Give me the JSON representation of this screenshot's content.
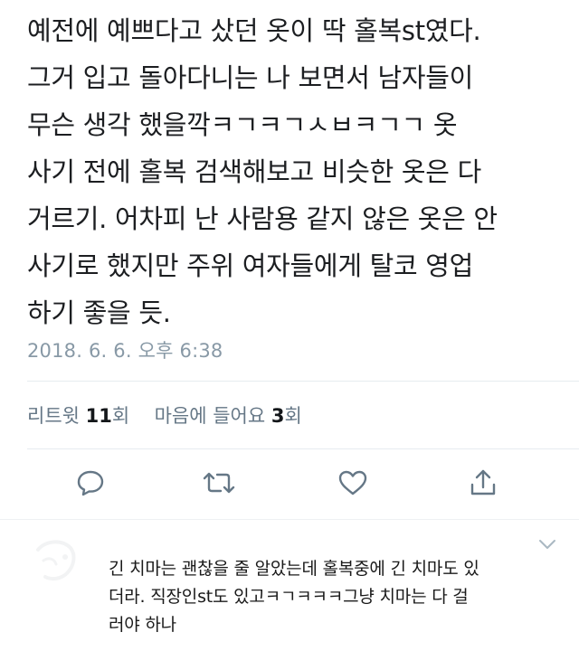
{
  "tweet": {
    "lines": [
      "예전에 예쁘다고 샀던 옷이 딱 홀복st였다.",
      "그거 입고 돌아다니는 나 보면서 남자들이",
      "무슨 생각 했을깍ㅋㄱㅋㄱㅅㅂㅋㄱㄱ 옷",
      "사기 전에 홀복 검색해보고 비슷한 옷은 다",
      "거르기. 어차피 난 사람용 같지 않은 옷은 안",
      "사기로 했지만 주위 여자들에게 탈코 영업",
      "하기 좋을 듯."
    ],
    "timestamp": "2018. 6. 6. 오후 6:38",
    "stats": {
      "retweet_label": "리트윗",
      "retweet_count": "11",
      "retweet_unit": "회",
      "like_label": "마음에 들어요",
      "like_count": "3",
      "like_unit": "회"
    }
  },
  "actions": {
    "icons": [
      "reply-icon",
      "retweet-icon",
      "like-icon",
      "share-icon"
    ],
    "color": "#657786"
  },
  "reply": {
    "lines": [
      "긴 치마는 괜찮을 줄 알았는데 홀복중에 긴 치마도 있",
      "더라. 직장인st도 있고ㅋㄱㅋㅋㅋ그냥 치마는 다 걸",
      "러야 하나"
    ]
  }
}
